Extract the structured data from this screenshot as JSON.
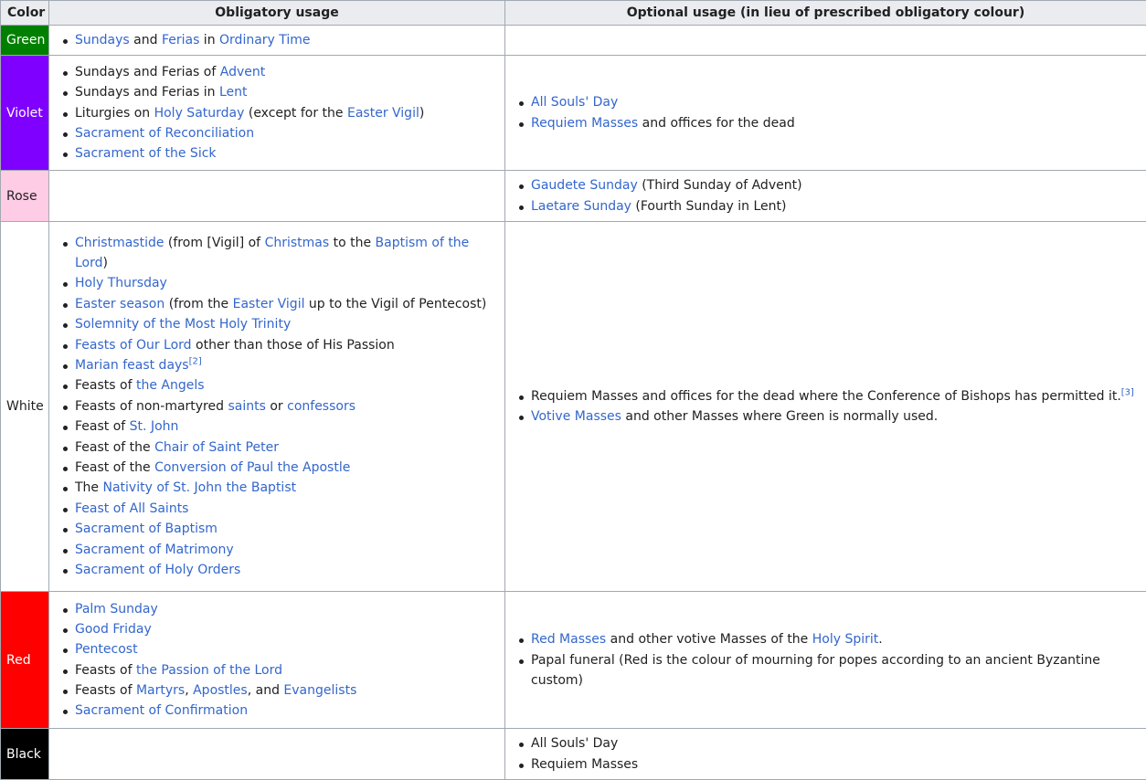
{
  "headers": [
    "Color",
    "Obligatory usage",
    "Optional usage (in lieu of prescribed obligatory colour)"
  ],
  "rows": [
    {
      "color_name": "Green",
      "bg": "#008000",
      "fg": "#ffffff",
      "obligatory": [
        [
          {
            "t": "Sundays",
            "l": true
          },
          {
            "t": " and "
          },
          {
            "t": "Ferias",
            "l": true
          },
          {
            "t": " in "
          },
          {
            "t": "Ordinary Time",
            "l": true
          }
        ]
      ],
      "optional": []
    },
    {
      "color_name": "Violet",
      "bg": "#8000ff",
      "fg": "#ffffff",
      "obligatory": [
        [
          {
            "t": "Sundays and Ferias of "
          },
          {
            "t": "Advent",
            "l": true
          }
        ],
        [
          {
            "t": "Sundays and Ferias in "
          },
          {
            "t": "Lent",
            "l": true
          }
        ],
        [
          {
            "t": "Liturgies on "
          },
          {
            "t": "Holy Saturday",
            "l": true
          },
          {
            "t": " (except for the "
          },
          {
            "t": "Easter Vigil",
            "l": true
          },
          {
            "t": ")"
          }
        ],
        [
          {
            "t": "Sacrament of Reconciliation",
            "l": true
          }
        ],
        [
          {
            "t": "Sacrament of the Sick",
            "l": true
          }
        ]
      ],
      "optional": [
        [
          {
            "t": "All Souls' Day",
            "l": true
          }
        ],
        [
          {
            "t": "Requiem Masses",
            "l": true
          },
          {
            "t": " and offices for the dead"
          }
        ]
      ]
    },
    {
      "color_name": "Rose",
      "bg": "#ffcce6",
      "fg": "#202122",
      "obligatory": [],
      "optional": [
        [
          {
            "t": "Gaudete Sunday",
            "l": true
          },
          {
            "t": " (Third Sunday of Advent)"
          }
        ],
        [
          {
            "t": "Laetare Sunday",
            "l": true
          },
          {
            "t": " (Fourth Sunday in Lent)"
          }
        ]
      ]
    },
    {
      "color_name": "White",
      "bg": "#ffffff",
      "fg": "#202122",
      "obligatory": [
        [
          {
            "t": "Christmastide",
            "l": true
          },
          {
            "t": " (from [Vigil] of "
          },
          {
            "t": "Christmas",
            "l": true
          },
          {
            "t": " to the "
          },
          {
            "t": "Baptism of the Lord",
            "l": true
          },
          {
            "t": ")"
          }
        ],
        [
          {
            "t": "Holy Thursday",
            "l": true
          }
        ],
        [
          {
            "t": "Easter season",
            "l": true
          },
          {
            "t": " (from the "
          },
          {
            "t": "Easter Vigil",
            "l": true
          },
          {
            "t": " up to the Vigil of Pentecost)"
          }
        ],
        [
          {
            "t": "Solemnity of the Most Holy Trinity",
            "l": true
          }
        ],
        [
          {
            "t": "Feasts of Our Lord",
            "l": true
          },
          {
            "t": " other than those of His Passion"
          }
        ],
        [
          {
            "t": "Marian feast days",
            "l": true
          },
          {
            "t": "[2]",
            "l": true,
            "sup": true
          }
        ],
        [
          {
            "t": "Feasts of "
          },
          {
            "t": "the Angels",
            "l": true
          }
        ],
        [
          {
            "t": "Feasts of non-martyred "
          },
          {
            "t": "saints",
            "l": true
          },
          {
            "t": " or "
          },
          {
            "t": "confessors",
            "l": true
          }
        ],
        [
          {
            "t": "Feast of "
          },
          {
            "t": "St. John",
            "l": true
          }
        ],
        [
          {
            "t": "Feast of the "
          },
          {
            "t": "Chair of Saint Peter",
            "l": true
          }
        ],
        [
          {
            "t": "Feast of the "
          },
          {
            "t": "Conversion of Paul the Apostle",
            "l": true
          }
        ],
        [
          {
            "t": "The "
          },
          {
            "t": "Nativity of St. John the Baptist",
            "l": true
          }
        ],
        [
          {
            "t": "Feast of All Saints",
            "l": true
          }
        ],
        [
          {
            "t": "Sacrament of Baptism",
            "l": true
          }
        ],
        [
          {
            "t": "Sacrament of Matrimony",
            "l": true
          }
        ],
        [
          {
            "t": "Sacrament of Holy Orders",
            "l": true
          }
        ]
      ],
      "optional": [
        [
          {
            "t": "Requiem Masses and offices for the dead where the Conference of Bishops has permitted it."
          },
          {
            "t": "[3]",
            "l": true,
            "sup": true
          }
        ],
        [
          {
            "t": "Votive Masses",
            "l": true
          },
          {
            "t": " and other Masses where Green is normally used."
          }
        ]
      ]
    },
    {
      "color_name": "Red",
      "bg": "#ff0000",
      "fg": "#ffffff",
      "obligatory": [
        [
          {
            "t": "Palm Sunday",
            "l": true
          }
        ],
        [
          {
            "t": "Good Friday",
            "l": true
          }
        ],
        [
          {
            "t": "Pentecost",
            "l": true
          }
        ],
        [
          {
            "t": "Feasts of "
          },
          {
            "t": "the Passion of the Lord",
            "l": true
          }
        ],
        [
          {
            "t": "Feasts of "
          },
          {
            "t": "Martyrs",
            "l": true
          },
          {
            "t": ", "
          },
          {
            "t": "Apostles",
            "l": true
          },
          {
            "t": ", and "
          },
          {
            "t": "Evangelists",
            "l": true
          }
        ],
        [
          {
            "t": "Sacrament of Confirmation",
            "l": true
          }
        ]
      ],
      "optional": [
        [
          {
            "t": "Red Masses",
            "l": true
          },
          {
            "t": " and other votive Masses of the "
          },
          {
            "t": "Holy Spirit",
            "l": true
          },
          {
            "t": "."
          }
        ],
        [
          {
            "t": "Papal funeral (Red is the colour of mourning for popes according to an ancient Byzantine custom)"
          }
        ]
      ]
    },
    {
      "color_name": "Black",
      "bg": "#000000",
      "fg": "#ffffff",
      "obligatory": [],
      "optional": [
        [
          {
            "t": "All Souls' Day"
          }
        ],
        [
          {
            "t": "Requiem Masses"
          }
        ]
      ]
    }
  ]
}
